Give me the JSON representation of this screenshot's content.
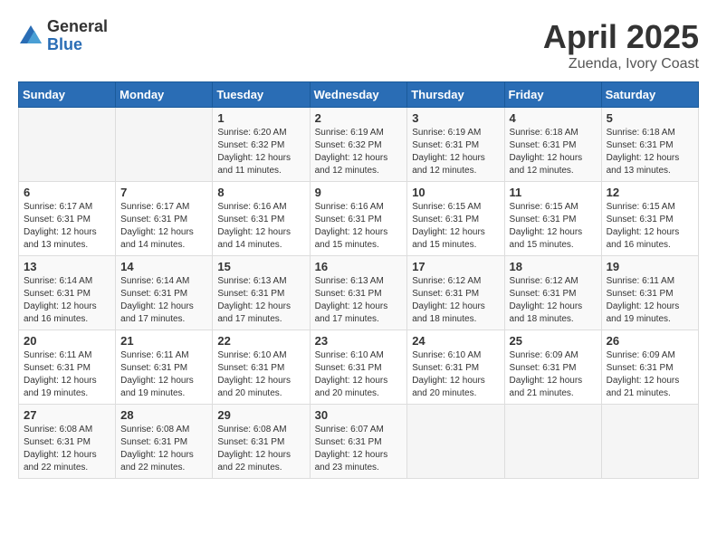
{
  "header": {
    "logo_general": "General",
    "logo_blue": "Blue",
    "title": "April 2025",
    "location": "Zuenda, Ivory Coast"
  },
  "weekdays": [
    "Sunday",
    "Monday",
    "Tuesday",
    "Wednesday",
    "Thursday",
    "Friday",
    "Saturday"
  ],
  "weeks": [
    [
      {
        "day": "",
        "sunrise": "",
        "sunset": "",
        "daylight": ""
      },
      {
        "day": "",
        "sunrise": "",
        "sunset": "",
        "daylight": ""
      },
      {
        "day": "1",
        "sunrise": "Sunrise: 6:20 AM",
        "sunset": "Sunset: 6:32 PM",
        "daylight": "Daylight: 12 hours and 11 minutes."
      },
      {
        "day": "2",
        "sunrise": "Sunrise: 6:19 AM",
        "sunset": "Sunset: 6:32 PM",
        "daylight": "Daylight: 12 hours and 12 minutes."
      },
      {
        "day": "3",
        "sunrise": "Sunrise: 6:19 AM",
        "sunset": "Sunset: 6:31 PM",
        "daylight": "Daylight: 12 hours and 12 minutes."
      },
      {
        "day": "4",
        "sunrise": "Sunrise: 6:18 AM",
        "sunset": "Sunset: 6:31 PM",
        "daylight": "Daylight: 12 hours and 12 minutes."
      },
      {
        "day": "5",
        "sunrise": "Sunrise: 6:18 AM",
        "sunset": "Sunset: 6:31 PM",
        "daylight": "Daylight: 12 hours and 13 minutes."
      }
    ],
    [
      {
        "day": "6",
        "sunrise": "Sunrise: 6:17 AM",
        "sunset": "Sunset: 6:31 PM",
        "daylight": "Daylight: 12 hours and 13 minutes."
      },
      {
        "day": "7",
        "sunrise": "Sunrise: 6:17 AM",
        "sunset": "Sunset: 6:31 PM",
        "daylight": "Daylight: 12 hours and 14 minutes."
      },
      {
        "day": "8",
        "sunrise": "Sunrise: 6:16 AM",
        "sunset": "Sunset: 6:31 PM",
        "daylight": "Daylight: 12 hours and 14 minutes."
      },
      {
        "day": "9",
        "sunrise": "Sunrise: 6:16 AM",
        "sunset": "Sunset: 6:31 PM",
        "daylight": "Daylight: 12 hours and 15 minutes."
      },
      {
        "day": "10",
        "sunrise": "Sunrise: 6:15 AM",
        "sunset": "Sunset: 6:31 PM",
        "daylight": "Daylight: 12 hours and 15 minutes."
      },
      {
        "day": "11",
        "sunrise": "Sunrise: 6:15 AM",
        "sunset": "Sunset: 6:31 PM",
        "daylight": "Daylight: 12 hours and 15 minutes."
      },
      {
        "day": "12",
        "sunrise": "Sunrise: 6:15 AM",
        "sunset": "Sunset: 6:31 PM",
        "daylight": "Daylight: 12 hours and 16 minutes."
      }
    ],
    [
      {
        "day": "13",
        "sunrise": "Sunrise: 6:14 AM",
        "sunset": "Sunset: 6:31 PM",
        "daylight": "Daylight: 12 hours and 16 minutes."
      },
      {
        "day": "14",
        "sunrise": "Sunrise: 6:14 AM",
        "sunset": "Sunset: 6:31 PM",
        "daylight": "Daylight: 12 hours and 17 minutes."
      },
      {
        "day": "15",
        "sunrise": "Sunrise: 6:13 AM",
        "sunset": "Sunset: 6:31 PM",
        "daylight": "Daylight: 12 hours and 17 minutes."
      },
      {
        "day": "16",
        "sunrise": "Sunrise: 6:13 AM",
        "sunset": "Sunset: 6:31 PM",
        "daylight": "Daylight: 12 hours and 17 minutes."
      },
      {
        "day": "17",
        "sunrise": "Sunrise: 6:12 AM",
        "sunset": "Sunset: 6:31 PM",
        "daylight": "Daylight: 12 hours and 18 minutes."
      },
      {
        "day": "18",
        "sunrise": "Sunrise: 6:12 AM",
        "sunset": "Sunset: 6:31 PM",
        "daylight": "Daylight: 12 hours and 18 minutes."
      },
      {
        "day": "19",
        "sunrise": "Sunrise: 6:11 AM",
        "sunset": "Sunset: 6:31 PM",
        "daylight": "Daylight: 12 hours and 19 minutes."
      }
    ],
    [
      {
        "day": "20",
        "sunrise": "Sunrise: 6:11 AM",
        "sunset": "Sunset: 6:31 PM",
        "daylight": "Daylight: 12 hours and 19 minutes."
      },
      {
        "day": "21",
        "sunrise": "Sunrise: 6:11 AM",
        "sunset": "Sunset: 6:31 PM",
        "daylight": "Daylight: 12 hours and 19 minutes."
      },
      {
        "day": "22",
        "sunrise": "Sunrise: 6:10 AM",
        "sunset": "Sunset: 6:31 PM",
        "daylight": "Daylight: 12 hours and 20 minutes."
      },
      {
        "day": "23",
        "sunrise": "Sunrise: 6:10 AM",
        "sunset": "Sunset: 6:31 PM",
        "daylight": "Daylight: 12 hours and 20 minutes."
      },
      {
        "day": "24",
        "sunrise": "Sunrise: 6:10 AM",
        "sunset": "Sunset: 6:31 PM",
        "daylight": "Daylight: 12 hours and 20 minutes."
      },
      {
        "day": "25",
        "sunrise": "Sunrise: 6:09 AM",
        "sunset": "Sunset: 6:31 PM",
        "daylight": "Daylight: 12 hours and 21 minutes."
      },
      {
        "day": "26",
        "sunrise": "Sunrise: 6:09 AM",
        "sunset": "Sunset: 6:31 PM",
        "daylight": "Daylight: 12 hours and 21 minutes."
      }
    ],
    [
      {
        "day": "27",
        "sunrise": "Sunrise: 6:08 AM",
        "sunset": "Sunset: 6:31 PM",
        "daylight": "Daylight: 12 hours and 22 minutes."
      },
      {
        "day": "28",
        "sunrise": "Sunrise: 6:08 AM",
        "sunset": "Sunset: 6:31 PM",
        "daylight": "Daylight: 12 hours and 22 minutes."
      },
      {
        "day": "29",
        "sunrise": "Sunrise: 6:08 AM",
        "sunset": "Sunset: 6:31 PM",
        "daylight": "Daylight: 12 hours and 22 minutes."
      },
      {
        "day": "30",
        "sunrise": "Sunrise: 6:07 AM",
        "sunset": "Sunset: 6:31 PM",
        "daylight": "Daylight: 12 hours and 23 minutes."
      },
      {
        "day": "",
        "sunrise": "",
        "sunset": "",
        "daylight": ""
      },
      {
        "day": "",
        "sunrise": "",
        "sunset": "",
        "daylight": ""
      },
      {
        "day": "",
        "sunrise": "",
        "sunset": "",
        "daylight": ""
      }
    ]
  ]
}
